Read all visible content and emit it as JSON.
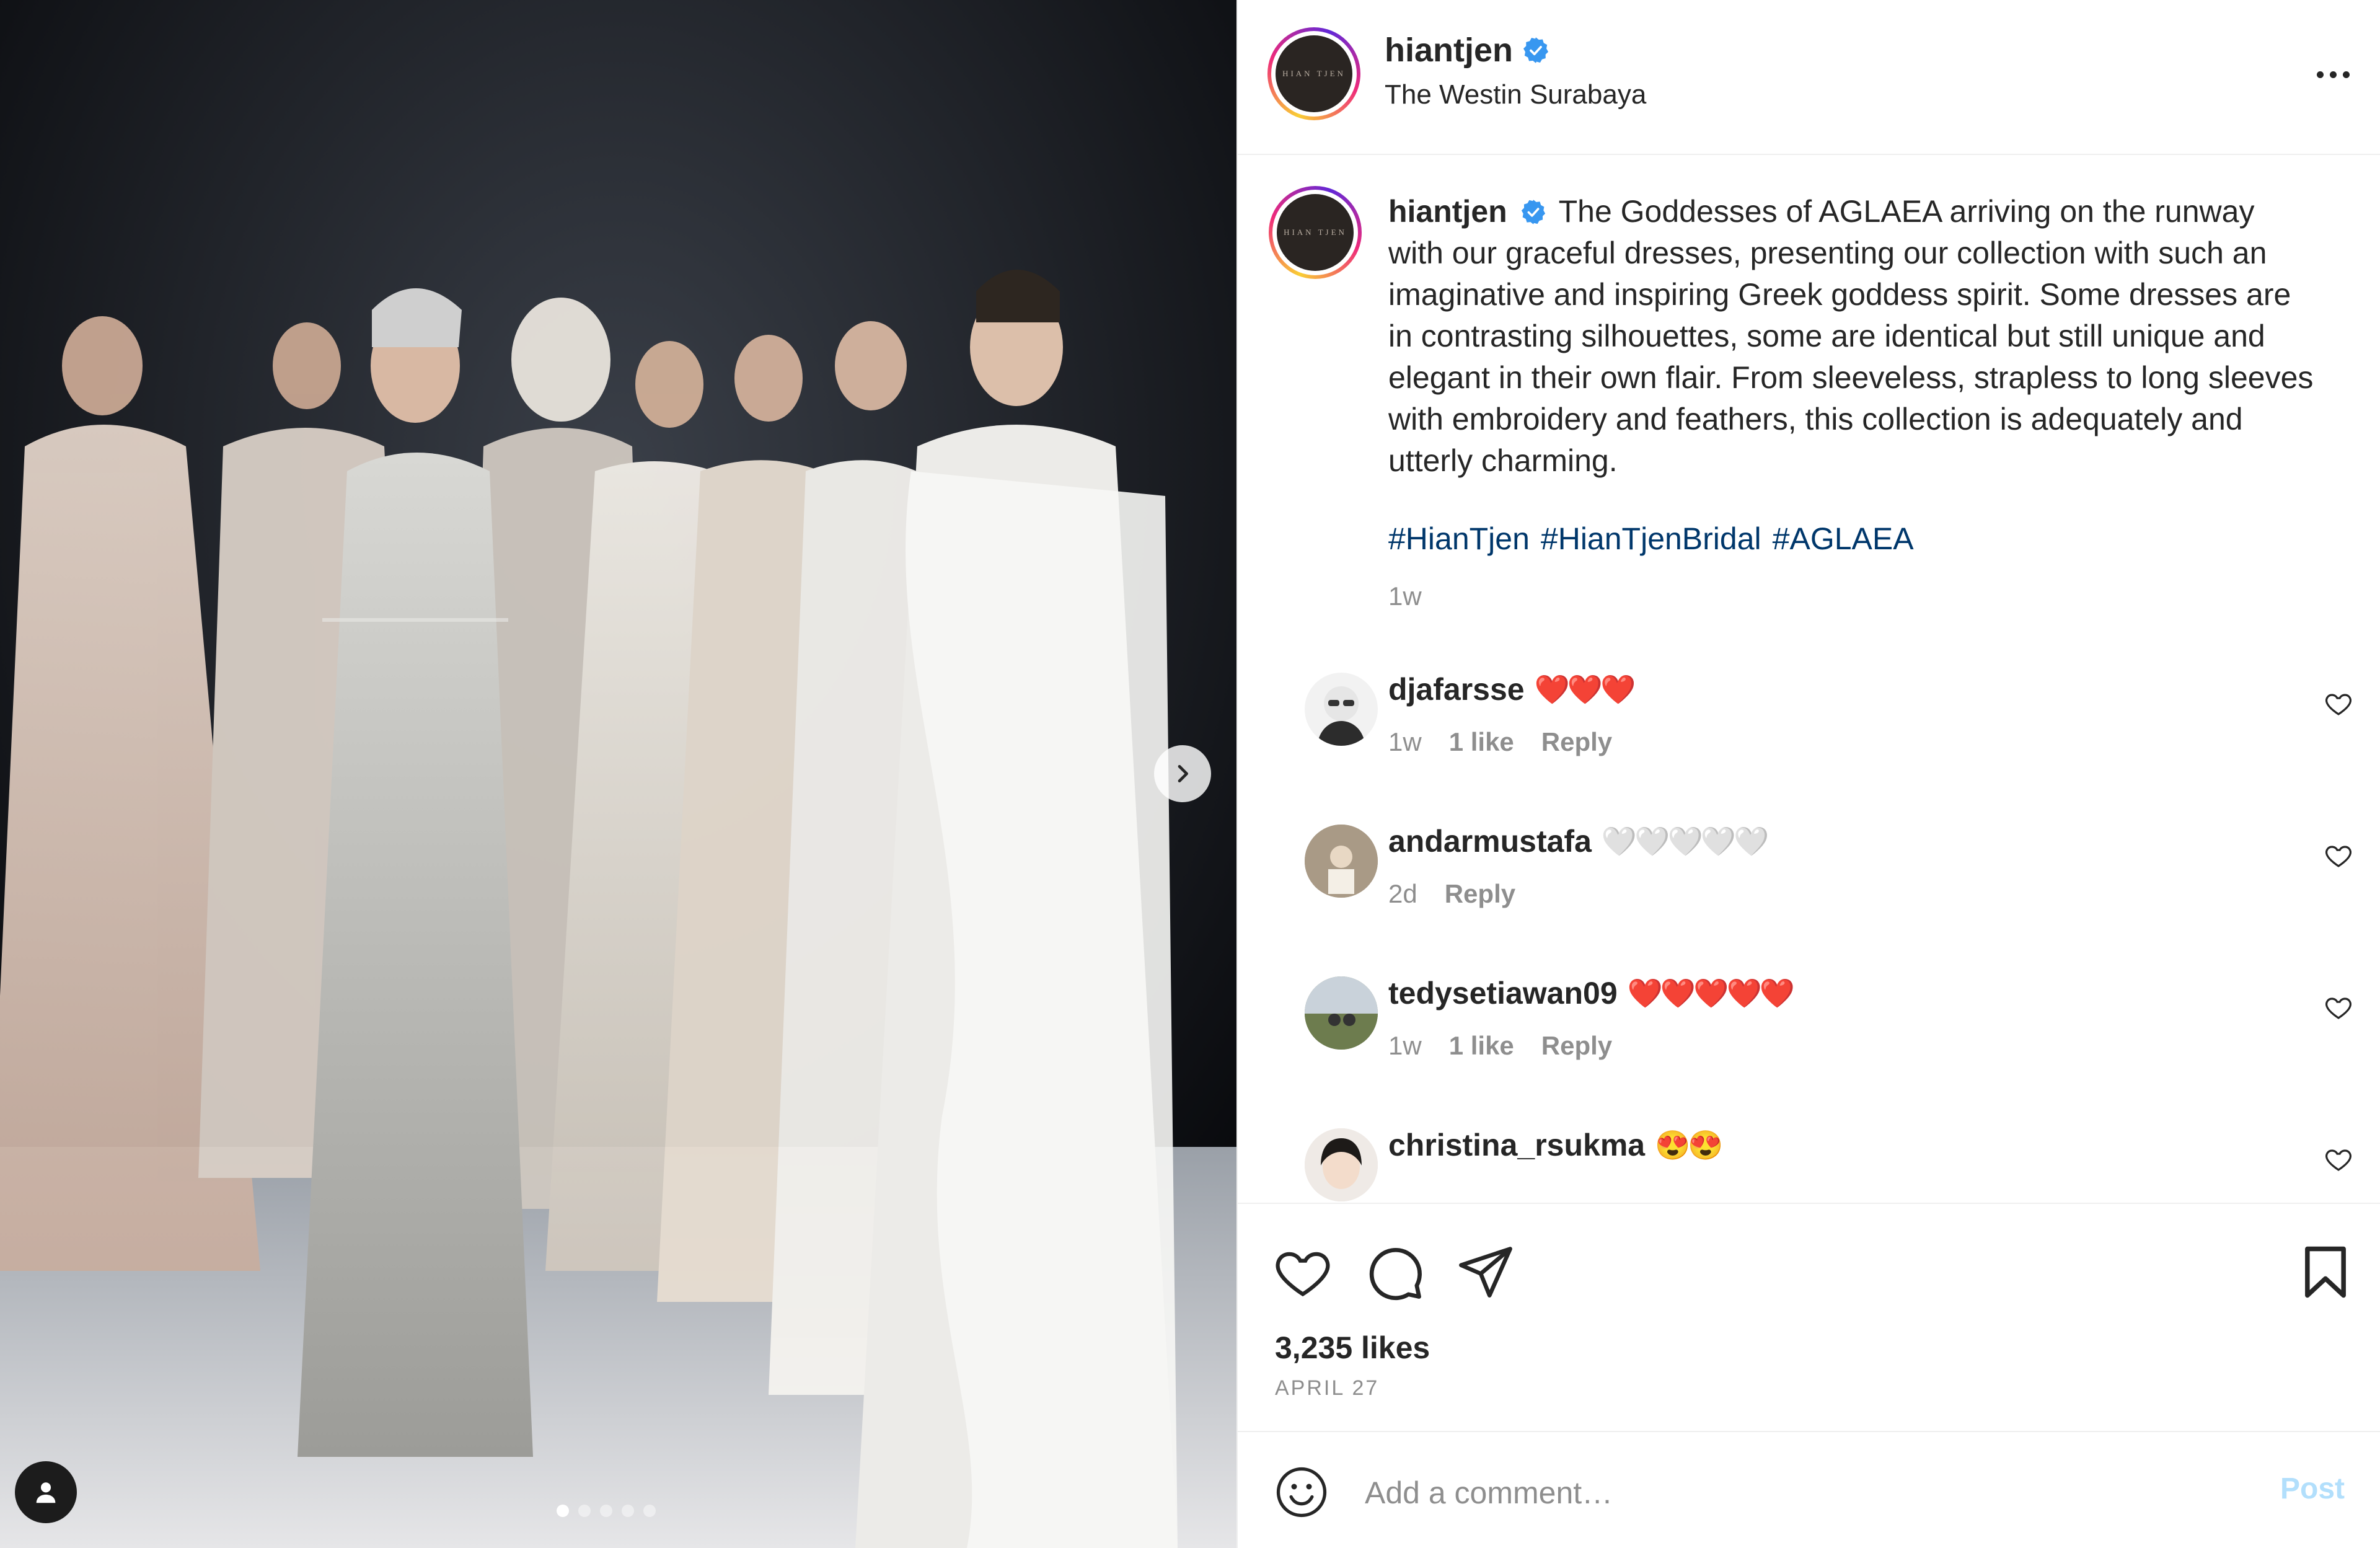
{
  "post": {
    "username": "hiantjen",
    "location": "The Westin Surabaya",
    "avatar_logo": "HIAN TJEN",
    "more_icon": "more-horizontal-icon"
  },
  "photo": {
    "alt_subject": "runway bridal gowns",
    "carousel_total": 5,
    "carousel_active": 1,
    "next_icon": "chevron-right-icon",
    "tag_icon": "user-tag-icon"
  },
  "caption": {
    "username": "hiantjen",
    "text": "The Goddesses of AGLAEA arriving on the runway with our graceful dresses, presenting our collection with such an imaginative and inspiring Greek goddess spirit. Some dresses are in contrasting silhouettes, some are identical but still unique and elegant in their own flair. From sleeveless, strapless to long sleeves with embroidery and feathers, this collection is adequately and utterly charming.",
    "hashtags": [
      "#HianTjen",
      "#HianTjenBridal",
      "#AGLAEA"
    ],
    "time": "1w"
  },
  "comments": [
    {
      "username": "djafarsse",
      "emoji": "❤️❤️❤️",
      "time": "1w",
      "likes": "1 like",
      "reply": "Reply"
    },
    {
      "username": "andarmustafa",
      "emoji": "🤍🤍🤍🤍🤍",
      "time": "2d",
      "likes": "",
      "reply": "Reply"
    },
    {
      "username": "tedysetiawan09",
      "emoji": "❤️❤️❤️❤️❤️",
      "time": "1w",
      "likes": "1 like",
      "reply": "Reply"
    },
    {
      "username": "christina_rsukma",
      "emoji": "😍😍",
      "time": "",
      "likes": "",
      "reply": ""
    }
  ],
  "actions": {
    "like_icon": "heart-icon",
    "comment_icon": "comment-icon",
    "share_icon": "send-icon",
    "save_icon": "bookmark-icon",
    "likes": "3,235 likes",
    "date": "APRIL 27"
  },
  "add_comment": {
    "placeholder": "Add a comment…",
    "post_label": "Post",
    "emoji_icon": "emoji-smiley-icon"
  },
  "colors": {
    "verified": "#3897f0",
    "hashtag": "#00376b",
    "muted": "#8e8e8e",
    "post_disabled": "#b2dffc"
  }
}
